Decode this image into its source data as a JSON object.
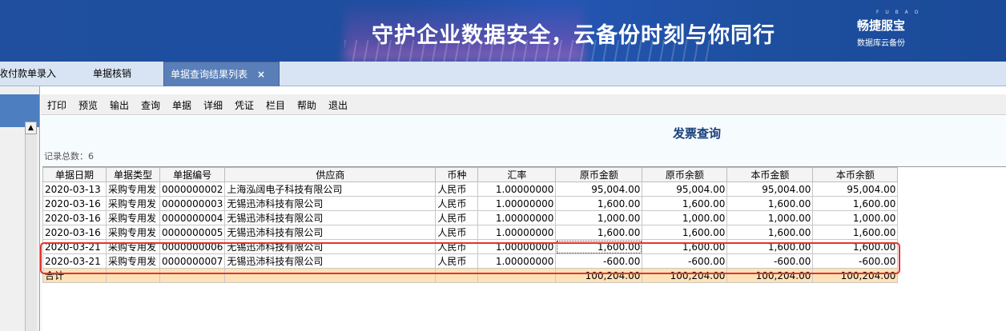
{
  "banner": {
    "slogan": "守护企业数据安全，云备份时刻与你同行",
    "brand_tiny": "F U B A O",
    "brand_name": "畅捷服宝",
    "brand_sub": "数据库云备份"
  },
  "tabs": [
    {
      "label": "收付款单录入"
    },
    {
      "label": "单据核销"
    },
    {
      "label": "单据查询结果列表",
      "close": "×"
    }
  ],
  "toolbar": [
    "打印",
    "预览",
    "输出",
    "查询",
    "单据",
    "详细",
    "凭证",
    "栏目",
    "帮助",
    "退出"
  ],
  "page": {
    "title": "发票查询",
    "count_label": "记录总数：",
    "count_value": "6"
  },
  "grid": {
    "columns": [
      "单据日期",
      "单据类型",
      "单据编号",
      "供应商",
      "币种",
      "汇率",
      "原币金额",
      "原币余额",
      "本币金额",
      "本币余额"
    ],
    "rows": [
      [
        "2020-03-13",
        "采购专用发",
        "0000000002",
        "上海泓阔电子科技有限公司",
        "人民币",
        "1.00000000",
        "95,004.00",
        "95,004.00",
        "95,004.00",
        "95,004.00"
      ],
      [
        "2020-03-16",
        "采购专用发",
        "0000000003",
        "无锡迅沛科技有限公司",
        "人民币",
        "1.00000000",
        "1,600.00",
        "1,600.00",
        "1,600.00",
        "1,600.00"
      ],
      [
        "2020-03-16",
        "采购专用发",
        "0000000004",
        "无锡迅沛科技有限公司",
        "人民币",
        "1.00000000",
        "1,000.00",
        "1,000.00",
        "1,000.00",
        "1,000.00"
      ],
      [
        "2020-03-16",
        "采购专用发",
        "0000000005",
        "无锡迅沛科技有限公司",
        "人民币",
        "1.00000000",
        "1,600.00",
        "1,600.00",
        "1,600.00",
        "1,600.00"
      ],
      [
        "2020-03-21",
        "采购专用发",
        "0000000006",
        "无锡迅沛科技有限公司",
        "人民币",
        "1.00000000",
        "1,600.00",
        "1,600.00",
        "1,600.00",
        "1,600.00"
      ],
      [
        "2020-03-21",
        "采购专用发",
        "0000000007",
        "无锡迅沛科技有限公司",
        "人民币",
        "1.00000000",
        "-600.00",
        "-600.00",
        "-600.00",
        "-600.00"
      ]
    ],
    "total": [
      "合计",
      "",
      "",
      "",
      "",
      "",
      "100,204.00",
      "100,204.00",
      "100,204.00",
      "100,204.00"
    ]
  },
  "colors": {
    "highlight": "#e8322b",
    "total_row": "#fde2b8",
    "active_tab": "#5a7fb8",
    "title": "#1a3f7a"
  }
}
